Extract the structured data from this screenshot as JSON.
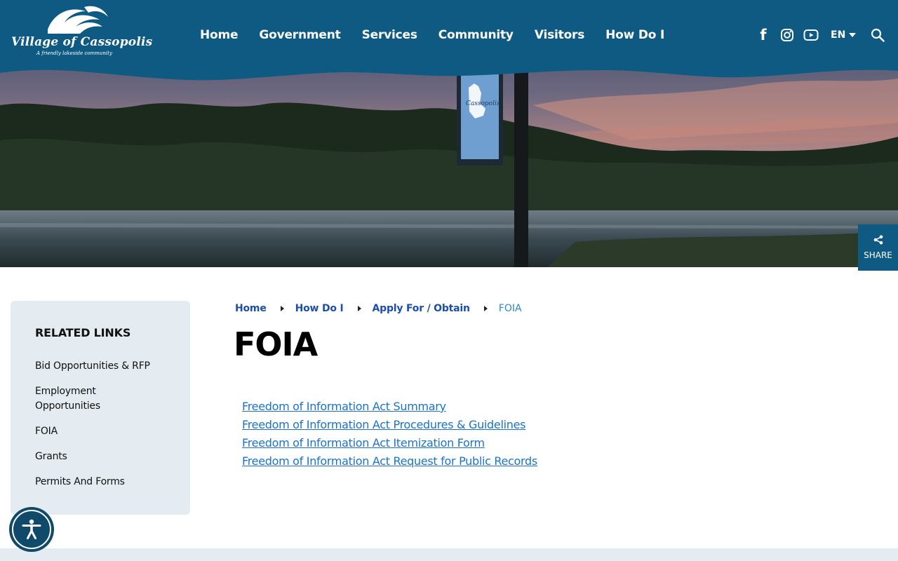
{
  "colors": {
    "brand": "#0f5a82",
    "link": "#1a73c9",
    "breadcrumb": "#1b4fa8",
    "sidebar_bg": "#e4ecf1"
  },
  "logo": {
    "title": "Village of Cassopolis",
    "tagline": "A friendly lakeside community"
  },
  "nav": {
    "items": [
      "Home",
      "Government",
      "Services",
      "Community",
      "Visitors",
      "How Do I"
    ]
  },
  "tools": {
    "facebook_glyph": "f",
    "language": "EN",
    "icons": [
      "facebook-icon",
      "instagram-icon",
      "youtube-icon",
      "chevron-down-icon",
      "search-icon"
    ]
  },
  "hero": {
    "sign_text": "Cassopolis"
  },
  "share": {
    "label": "SHARE",
    "icon": "share-icon"
  },
  "sidebar": {
    "title": "RELATED LINKS",
    "items": [
      "Bid Opportunities & RFP",
      "Employment Opportunities",
      "FOIA",
      "Grants",
      "Permits And Forms"
    ]
  },
  "breadcrumb": {
    "items": [
      "Home",
      "How Do I",
      "Apply For / Obtain"
    ],
    "current": "FOIA"
  },
  "main": {
    "title": "FOIA",
    "links": [
      "Freedom of Information Act Summary",
      "Freedom of Information Act Procedures & Guidelines",
      "Freedom of Information Act Itemization Form",
      "Freedom of Information Act Request for Public Records"
    ]
  },
  "accessibility": {
    "icon": "accessibility-icon"
  }
}
